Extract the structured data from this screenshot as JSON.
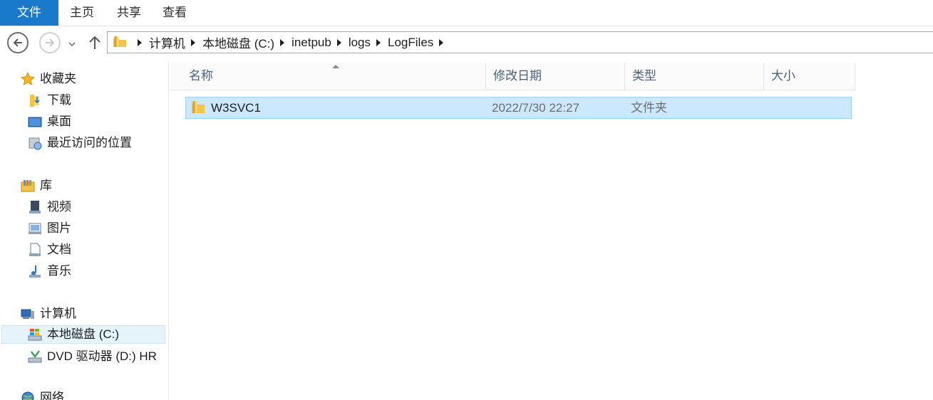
{
  "ribbon": {
    "tabs": [
      "文件",
      "主页",
      "共享",
      "查看"
    ]
  },
  "address": {
    "crumbs": [
      "计算机",
      "本地磁盘 (C:)",
      "inetpub",
      "logs",
      "LogFiles"
    ]
  },
  "nav": {
    "favorites": "收藏夹",
    "downloads": "下载",
    "desktop": "桌面",
    "recent": "最近访问的位置",
    "libraries": "库",
    "videos": "视频",
    "pictures": "图片",
    "documents": "文档",
    "music": "音乐",
    "computer": "计算机",
    "local_disk": "本地磁盘 (C:)",
    "dvd": "DVD 驱动器 (D:) HR",
    "network": "网络"
  },
  "columns": {
    "name": "名称",
    "date": "修改日期",
    "type": "类型",
    "size": "大小"
  },
  "files": [
    {
      "name": "W3SVC1",
      "date": "2022/7/30 22:27",
      "type": "文件夹",
      "size": ""
    }
  ],
  "colors": {
    "accent": "#1979ca",
    "selection": "#cce8ff",
    "selection_border": "#99d1ff"
  }
}
